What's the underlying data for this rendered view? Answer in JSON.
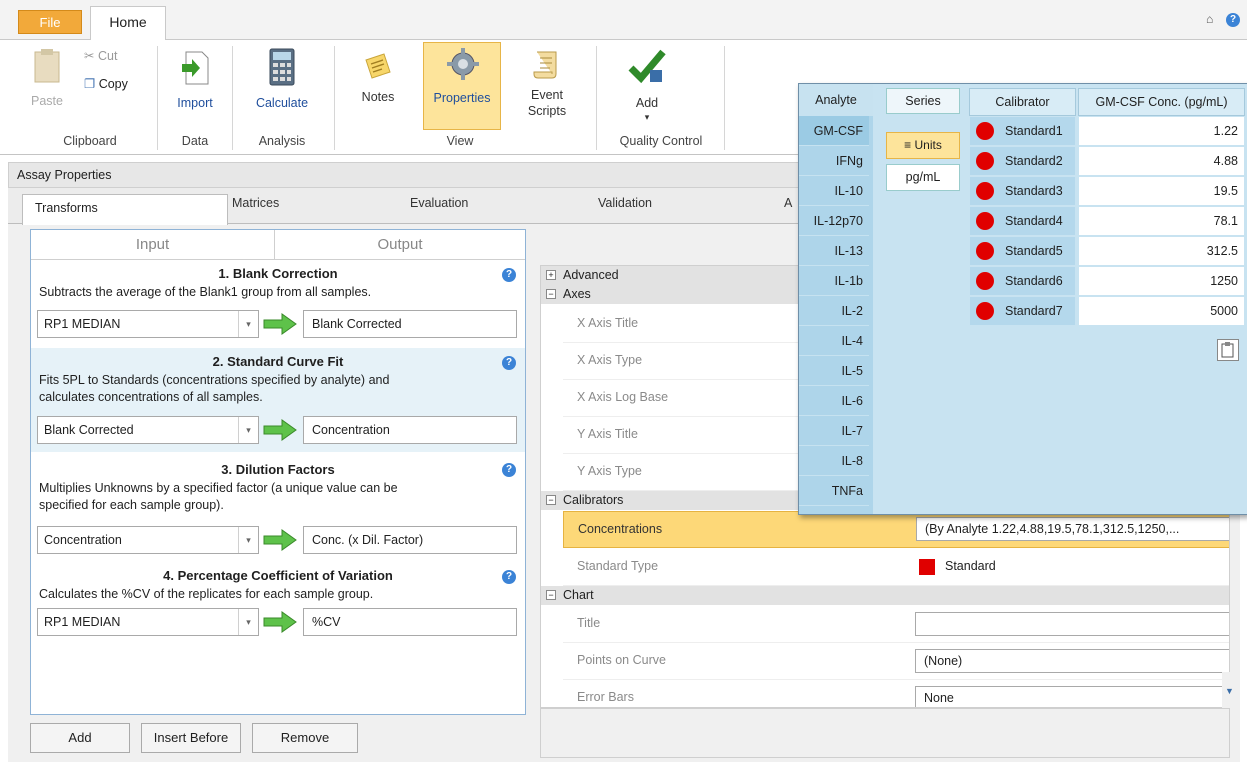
{
  "ribbon": {
    "tabs": {
      "file": "File",
      "home": "Home"
    },
    "clipboard": {
      "paste": "Paste",
      "cut": "Cut",
      "copy": "Copy",
      "group": "Clipboard"
    },
    "data": {
      "import": "Import",
      "group": "Data"
    },
    "analysis": {
      "calculate": "Calculate",
      "group": "Analysis"
    },
    "view": {
      "notes": "Notes",
      "properties": "Properties",
      "event_scripts_1": "Event",
      "event_scripts_2": "Scripts",
      "group": "View"
    },
    "qc": {
      "add": "Add",
      "group": "Quality Control"
    }
  },
  "assay": {
    "header": "Assay Properties",
    "tabs": [
      "Transforms",
      "Matrices",
      "Evaluation",
      "Validation",
      "A"
    ],
    "io_tabs": {
      "input": "Input",
      "output": "Output"
    },
    "transforms": [
      {
        "title": "1. Blank Correction",
        "desc1": "Subtracts the average of the Blank1 group from all samples.",
        "desc2": "",
        "input": "RP1 MEDIAN",
        "output": "Blank Corrected"
      },
      {
        "title": "2. Standard Curve Fit",
        "desc1": "Fits 5PL to Standards (concentrations specified by analyte) and",
        "desc2": "calculates concentrations of all samples.",
        "input": "Blank Corrected",
        "output": "Concentration"
      },
      {
        "title": "3. Dilution Factors",
        "desc1": "Multiplies Unknowns by a specified factor (a unique value can be",
        "desc2": "specified for each sample group).",
        "input": "Concentration",
        "output": "Conc. (x Dil. Factor)"
      },
      {
        "title": "4. Percentage Coefficient of Variation",
        "desc1": "Calculates the %CV of the replicates for each sample group.",
        "desc2": "",
        "input": "RP1 MEDIAN",
        "output": "%CV"
      }
    ],
    "buttons": {
      "add": "Add",
      "insert_before": "Insert Before",
      "remove": "Remove"
    }
  },
  "property_grid": {
    "advanced": "Advanced",
    "axes": "Axes",
    "axes_rows": [
      "X Axis Title",
      "X Axis Type",
      "X Axis Log Base",
      "Y Axis Title",
      "Y Axis Type"
    ],
    "calibrators": "Calibrators",
    "concentrations_label": "Concentrations",
    "concentrations_value": "(By Analyte 1.22,4.88,19.5,78.1,312.5,1250,...",
    "standard_type_label": "Standard Type",
    "standard_type_value": "Standard",
    "chart": "Chart",
    "title_label": "Title",
    "title_value": "",
    "points_label": "Points on Curve",
    "points_value": "(None)",
    "error_bars_label": "Error Bars",
    "error_bars_value": "None"
  },
  "popup": {
    "analyte_header": "Analyte",
    "analytes": [
      "GM-CSF",
      "IFNg",
      "IL-10",
      "IL-12p70",
      "IL-13",
      "IL-1b",
      "IL-2",
      "IL-4",
      "IL-5",
      "IL-6",
      "IL-7",
      "IL-8",
      "TNFa"
    ],
    "series_label": "Series",
    "units_label": "≡ Units",
    "units_value": "pg/mL",
    "calibrator_header": "Calibrator",
    "conc_header": "GM-CSF Conc. (pg/mL)",
    "calibrators": [
      {
        "name": "Standard1",
        "conc": "1.22"
      },
      {
        "name": "Standard2",
        "conc": "4.88"
      },
      {
        "name": "Standard3",
        "conc": "19.5"
      },
      {
        "name": "Standard4",
        "conc": "78.1"
      },
      {
        "name": "Standard5",
        "conc": "312.5"
      },
      {
        "name": "Standard6",
        "conc": "1250"
      },
      {
        "name": "Standard7",
        "conc": "5000"
      }
    ]
  },
  "colors": {
    "accent": "#fde49b",
    "file_tab": "#f2a93a",
    "calibrator_dot": "#e00000",
    "popup_bg": "#c8e3f1"
  }
}
